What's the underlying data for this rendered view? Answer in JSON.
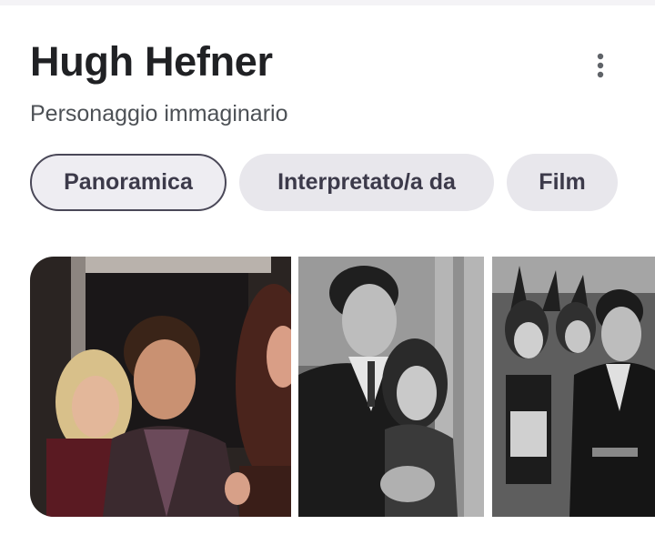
{
  "header": {
    "title": "Hugh Hefner",
    "subtitle": "Personaggio immaginario",
    "more_icon": "more-vert-icon"
  },
  "tabs": [
    {
      "label": "Panoramica",
      "selected": true
    },
    {
      "label": "Interpretato/a da",
      "selected": false
    },
    {
      "label": "Film",
      "selected": false
    }
  ],
  "images": [
    {
      "description_icon": "photo-color-group"
    },
    {
      "description_icon": "photo-bw-couple"
    },
    {
      "description_icon": "photo-bw-group"
    }
  ],
  "colors": {
    "title": "#202124",
    "subtitle": "#4d5156",
    "chip_bg": "#e8e7ec",
    "chip_text": "#3c3a4a",
    "chip_selected_border": "#4a4858"
  }
}
